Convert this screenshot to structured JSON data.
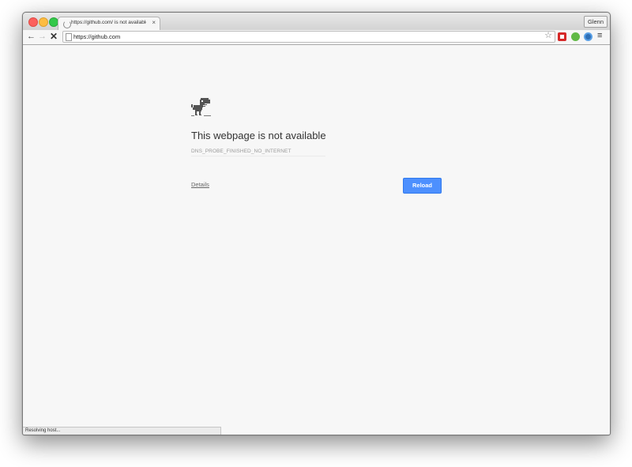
{
  "tab": {
    "title": "https://github.com/ is not available",
    "close_icon": "×"
  },
  "profile": {
    "label": "Glenn"
  },
  "toolbar": {
    "back_icon": "←",
    "forward_icon": "→",
    "stop_icon": "✕",
    "url": "https://github.com",
    "star_icon": "☆",
    "menu_icon": "≡"
  },
  "error": {
    "title": "This webpage is not available",
    "code": "DNS_PROBE_FINISHED_NO_INTERNET",
    "details_label": "Details",
    "reload_label": "Reload"
  },
  "status": {
    "text": "Resolving host..."
  },
  "colors": {
    "accent": "#4d90fe",
    "page_bg": "#f7f7f7"
  }
}
